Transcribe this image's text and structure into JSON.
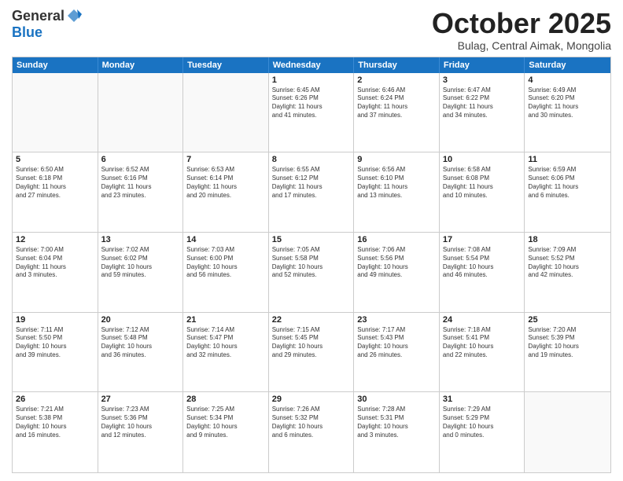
{
  "header": {
    "logo_general": "General",
    "logo_blue": "Blue",
    "month_title": "October 2025",
    "location": "Bulag, Central Aimak, Mongolia"
  },
  "days_of_week": [
    "Sunday",
    "Monday",
    "Tuesday",
    "Wednesday",
    "Thursday",
    "Friday",
    "Saturday"
  ],
  "rows": [
    [
      {
        "date": "",
        "info": ""
      },
      {
        "date": "",
        "info": ""
      },
      {
        "date": "",
        "info": ""
      },
      {
        "date": "1",
        "info": "Sunrise: 6:45 AM\nSunset: 6:26 PM\nDaylight: 11 hours\nand 41 minutes."
      },
      {
        "date": "2",
        "info": "Sunrise: 6:46 AM\nSunset: 6:24 PM\nDaylight: 11 hours\nand 37 minutes."
      },
      {
        "date": "3",
        "info": "Sunrise: 6:47 AM\nSunset: 6:22 PM\nDaylight: 11 hours\nand 34 minutes."
      },
      {
        "date": "4",
        "info": "Sunrise: 6:49 AM\nSunset: 6:20 PM\nDaylight: 11 hours\nand 30 minutes."
      }
    ],
    [
      {
        "date": "5",
        "info": "Sunrise: 6:50 AM\nSunset: 6:18 PM\nDaylight: 11 hours\nand 27 minutes."
      },
      {
        "date": "6",
        "info": "Sunrise: 6:52 AM\nSunset: 6:16 PM\nDaylight: 11 hours\nand 23 minutes."
      },
      {
        "date": "7",
        "info": "Sunrise: 6:53 AM\nSunset: 6:14 PM\nDaylight: 11 hours\nand 20 minutes."
      },
      {
        "date": "8",
        "info": "Sunrise: 6:55 AM\nSunset: 6:12 PM\nDaylight: 11 hours\nand 17 minutes."
      },
      {
        "date": "9",
        "info": "Sunrise: 6:56 AM\nSunset: 6:10 PM\nDaylight: 11 hours\nand 13 minutes."
      },
      {
        "date": "10",
        "info": "Sunrise: 6:58 AM\nSunset: 6:08 PM\nDaylight: 11 hours\nand 10 minutes."
      },
      {
        "date": "11",
        "info": "Sunrise: 6:59 AM\nSunset: 6:06 PM\nDaylight: 11 hours\nand 6 minutes."
      }
    ],
    [
      {
        "date": "12",
        "info": "Sunrise: 7:00 AM\nSunset: 6:04 PM\nDaylight: 11 hours\nand 3 minutes."
      },
      {
        "date": "13",
        "info": "Sunrise: 7:02 AM\nSunset: 6:02 PM\nDaylight: 10 hours\nand 59 minutes."
      },
      {
        "date": "14",
        "info": "Sunrise: 7:03 AM\nSunset: 6:00 PM\nDaylight: 10 hours\nand 56 minutes."
      },
      {
        "date": "15",
        "info": "Sunrise: 7:05 AM\nSunset: 5:58 PM\nDaylight: 10 hours\nand 52 minutes."
      },
      {
        "date": "16",
        "info": "Sunrise: 7:06 AM\nSunset: 5:56 PM\nDaylight: 10 hours\nand 49 minutes."
      },
      {
        "date": "17",
        "info": "Sunrise: 7:08 AM\nSunset: 5:54 PM\nDaylight: 10 hours\nand 46 minutes."
      },
      {
        "date": "18",
        "info": "Sunrise: 7:09 AM\nSunset: 5:52 PM\nDaylight: 10 hours\nand 42 minutes."
      }
    ],
    [
      {
        "date": "19",
        "info": "Sunrise: 7:11 AM\nSunset: 5:50 PM\nDaylight: 10 hours\nand 39 minutes."
      },
      {
        "date": "20",
        "info": "Sunrise: 7:12 AM\nSunset: 5:48 PM\nDaylight: 10 hours\nand 36 minutes."
      },
      {
        "date": "21",
        "info": "Sunrise: 7:14 AM\nSunset: 5:47 PM\nDaylight: 10 hours\nand 32 minutes."
      },
      {
        "date": "22",
        "info": "Sunrise: 7:15 AM\nSunset: 5:45 PM\nDaylight: 10 hours\nand 29 minutes."
      },
      {
        "date": "23",
        "info": "Sunrise: 7:17 AM\nSunset: 5:43 PM\nDaylight: 10 hours\nand 26 minutes."
      },
      {
        "date": "24",
        "info": "Sunrise: 7:18 AM\nSunset: 5:41 PM\nDaylight: 10 hours\nand 22 minutes."
      },
      {
        "date": "25",
        "info": "Sunrise: 7:20 AM\nSunset: 5:39 PM\nDaylight: 10 hours\nand 19 minutes."
      }
    ],
    [
      {
        "date": "26",
        "info": "Sunrise: 7:21 AM\nSunset: 5:38 PM\nDaylight: 10 hours\nand 16 minutes."
      },
      {
        "date": "27",
        "info": "Sunrise: 7:23 AM\nSunset: 5:36 PM\nDaylight: 10 hours\nand 12 minutes."
      },
      {
        "date": "28",
        "info": "Sunrise: 7:25 AM\nSunset: 5:34 PM\nDaylight: 10 hours\nand 9 minutes."
      },
      {
        "date": "29",
        "info": "Sunrise: 7:26 AM\nSunset: 5:32 PM\nDaylight: 10 hours\nand 6 minutes."
      },
      {
        "date": "30",
        "info": "Sunrise: 7:28 AM\nSunset: 5:31 PM\nDaylight: 10 hours\nand 3 minutes."
      },
      {
        "date": "31",
        "info": "Sunrise: 7:29 AM\nSunset: 5:29 PM\nDaylight: 10 hours\nand 0 minutes."
      },
      {
        "date": "",
        "info": ""
      }
    ]
  ]
}
